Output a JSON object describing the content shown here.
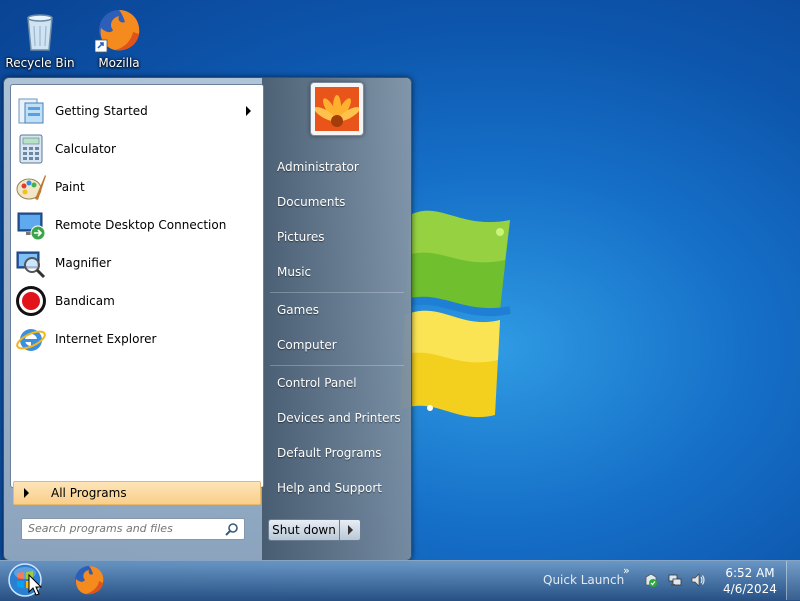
{
  "desktop": {
    "icons": [
      {
        "label": "Recycle Bin",
        "icon": "recycle-bin-icon"
      },
      {
        "label": "Mozilla",
        "icon": "firefox-icon"
      }
    ]
  },
  "start_menu": {
    "programs": [
      {
        "label": "Getting Started",
        "icon": "getting-started-icon",
        "has_submenu": true
      },
      {
        "label": "Calculator",
        "icon": "calculator-icon"
      },
      {
        "label": "Paint",
        "icon": "paint-icon"
      },
      {
        "label": "Remote Desktop Connection",
        "icon": "remote-desktop-icon"
      },
      {
        "label": "Magnifier",
        "icon": "magnifier-icon"
      },
      {
        "label": "Bandicam",
        "icon": "bandicam-icon"
      },
      {
        "label": "Internet Explorer",
        "icon": "internet-explorer-icon"
      }
    ],
    "all_programs": "All Programs",
    "search_placeholder": "Search programs and files",
    "right_items": [
      "Administrator",
      "Documents",
      "Pictures",
      "Music",
      "Games",
      "Computer",
      "Control Panel",
      "Devices and Printers",
      "Default Programs",
      "Help and Support"
    ],
    "shutdown_label": "Shut down"
  },
  "taskbar": {
    "quick_launch": "Quick Launch",
    "overflow": "»",
    "clock_time": "6:52 AM",
    "clock_date": "4/6/2024"
  },
  "colors": {
    "desktop_blue": "#1670c8",
    "all_programs_highlight": "#f9cf8a"
  }
}
